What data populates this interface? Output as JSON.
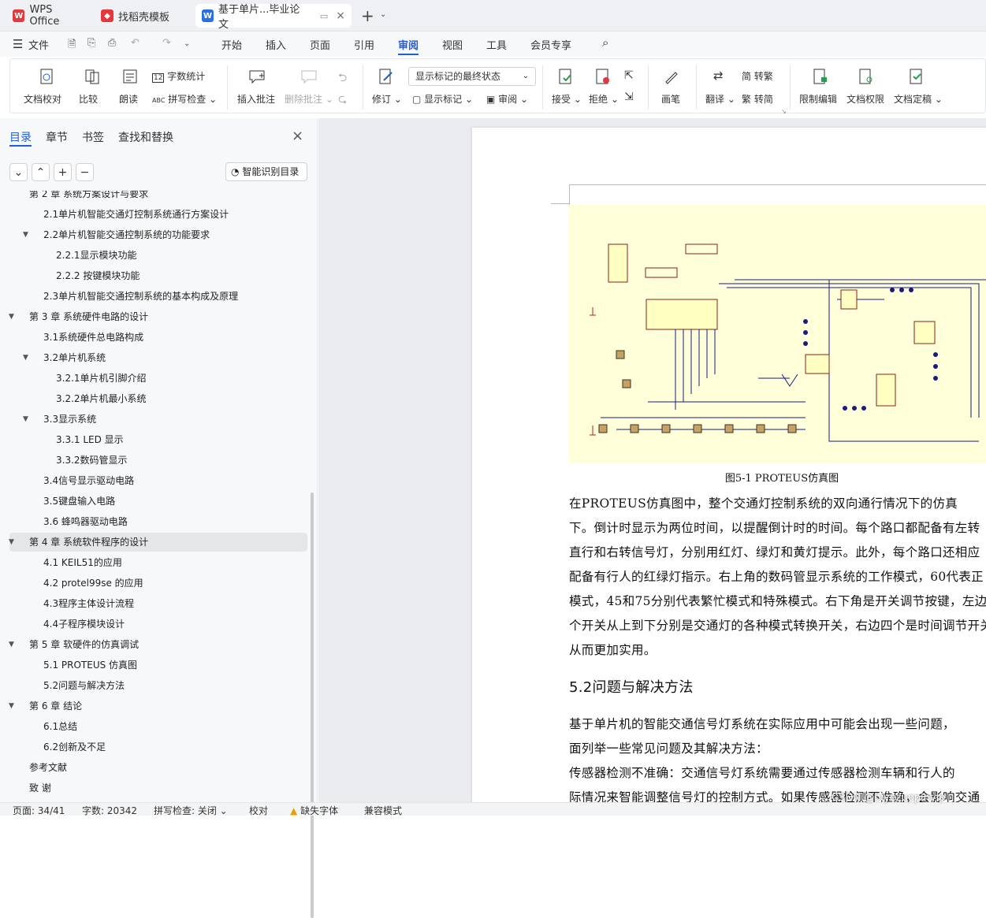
{
  "tabs": [
    {
      "label": "WPS Office"
    },
    {
      "label": "找稻壳模板"
    },
    {
      "label": "基于单片...毕业论文"
    }
  ],
  "menu": {
    "file": "文件",
    "items": [
      "开始",
      "插入",
      "页面",
      "引用",
      "审阅",
      "视图",
      "工具",
      "会员专享"
    ]
  },
  "ribbon": {
    "doc_check": "文档校对",
    "compare": "比较",
    "read": "朗读",
    "word_count": "字数统计",
    "spell_check": "拼写检查",
    "insert_comment": "插入批注",
    "delete_comment": "删除批注",
    "revise": "修订",
    "display_state": "显示标记的最终状态",
    "show_markup": "显示标记",
    "review": "审阅",
    "accept": "接受",
    "reject": "拒绝",
    "pen": "画笔",
    "translate": "翻译",
    "trad": "简 转繁",
    "simp": "繁 转简",
    "restrict_edit": "限制编辑",
    "doc_perm": "文档权限",
    "finalize": "文档定稿"
  },
  "sidebar": {
    "tabs": [
      "目录",
      "章节",
      "书签",
      "查找和替换"
    ],
    "smart_toc": "智能识别目录",
    "items": [
      {
        "t": "第 2 章  系统方案设计与要求",
        "lv": 1
      },
      {
        "t": "2.1单片机智能交通灯控制系统通行方案设计",
        "lv": 2
      },
      {
        "t": "2.2单片机智能交通控制系统的功能要求",
        "lv": 2,
        "exp": true
      },
      {
        "t": "2.2.1显示模块功能",
        "lv": 3
      },
      {
        "t": "2.2.2  按键模块功能",
        "lv": 3
      },
      {
        "t": "2.3单片机智能交通控制系统的基本构成及原理",
        "lv": 2
      },
      {
        "t": "第 3 章  系统硬件电路的设计",
        "lv": 1,
        "exp": true
      },
      {
        "t": "3.1系统硬件总电路构成",
        "lv": 2
      },
      {
        "t": "3.2单片机系统",
        "lv": 2,
        "exp": true
      },
      {
        "t": "3.2.1单片机引脚介绍",
        "lv": 3
      },
      {
        "t": "3.2.2单片机最小系统",
        "lv": 3
      },
      {
        "t": "3.3显示系统",
        "lv": 2,
        "exp": true
      },
      {
        "t": "3.3.1 LED 显示",
        "lv": 3
      },
      {
        "t": "3.3.2数码管显示",
        "lv": 3
      },
      {
        "t": "3.4信号显示驱动电路",
        "lv": 2
      },
      {
        "t": "3.5键盘输入电路",
        "lv": 2
      },
      {
        "t": "3.6  蜂鸣器驱动电路",
        "lv": 2
      },
      {
        "t": "第 4 章  系统软件程序的设计",
        "lv": 1,
        "exp": true,
        "sel": true
      },
      {
        "t": "4.1 KEIL51的应用",
        "lv": 2
      },
      {
        "t": "4.2 protel99se 的应用",
        "lv": 2
      },
      {
        "t": "4.3程序主体设计流程",
        "lv": 2
      },
      {
        "t": "4.4子程序模块设计",
        "lv": 2
      },
      {
        "t": "第 5 章  软硬件的仿真调试",
        "lv": 1,
        "exp": true
      },
      {
        "t": "5.1 PROTEUS 仿真图",
        "lv": 2
      },
      {
        "t": "5.2问题与解决方法",
        "lv": 2
      },
      {
        "t": "第 6 章  结论",
        "lv": 1,
        "exp": true
      },
      {
        "t": "6.1总结",
        "lv": 2
      },
      {
        "t": "6.2创新及不足",
        "lv": 2
      },
      {
        "t": "参考文献",
        "lv": 1
      },
      {
        "t": "致    谢",
        "lv": 1
      }
    ]
  },
  "document": {
    "caption": "图5-1 PROTEUS仿真图",
    "paragraphs": [
      "    在PROTEUS仿真图中，整个交通灯控制系统的双向通行情况下的仿真",
      "下。倒计时显示为两位时间，以提醒倒计时的时间。每个路口都配备有左转",
      "直行和右转信号灯，分别用红灯、绿灯和黄灯提示。此外，每个路口还相应",
      "配备有行人的红绿灯指示。右上角的数码管显示系统的工作模式，60代表正",
      "模式，45和75分别代表繁忙模式和特殊模式。右下角是开关调节按键，左边",
      "个开关从上到下分别是交通灯的各种模式转换开关，右边四个是时间调节开关",
      "从而更加实用。"
    ],
    "heading": "5.2问题与解决方法",
    "paragraphs2": [
      "    基于单片机的智能交通信号灯系统在实际应用中可能会出现一些问题，",
      "面列举一些常见问题及其解决方法：",
      "    传感器检测不准确：交通信号灯系统需要通过传感器检测车辆和行人的",
      "际情况来智能调整信号灯的控制方式。如果传感器检测不准确，会影响交通"
    ]
  },
  "status": {
    "page": "页面: 34/41",
    "words": "字数: 20342",
    "spell": "拼写检查: 关闭",
    "proof": "校对",
    "missing_font": "缺失字体",
    "compat": "兼容模式",
    "watermark": "CSDN @biyezuopinvip"
  },
  "colors": {
    "accent": "#1e5ed8",
    "schematic_bg": "#ffffd9",
    "wire": "#1a1a80"
  }
}
